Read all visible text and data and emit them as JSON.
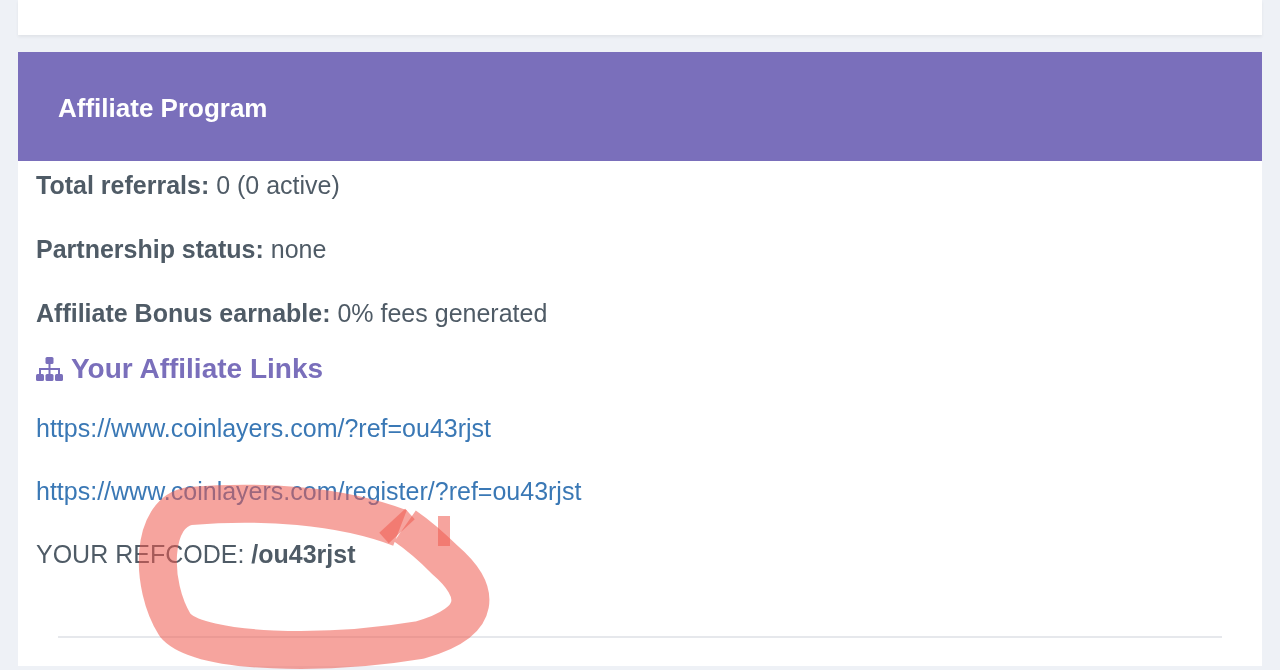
{
  "card": {
    "title": "Affiliate Program",
    "stats": [
      "**Total referrals:** 0 (0 active)",
      "**Partnership status:** none",
      "**Affiliate Bonus earnable:** 0% fees generated"
    ],
    "links_heading": "Your Affiliate Links",
    "links": [
      "https://www.coinlayers.com/?ref=ou43rjst",
      "https://www.coinlayers.com/register/?ref=ou43rjst"
    ],
    "refcode": "YOUR REFCODE: **/ou43rjst**"
  },
  "annotation": {
    "kind": "freehand-loop"
  }
}
